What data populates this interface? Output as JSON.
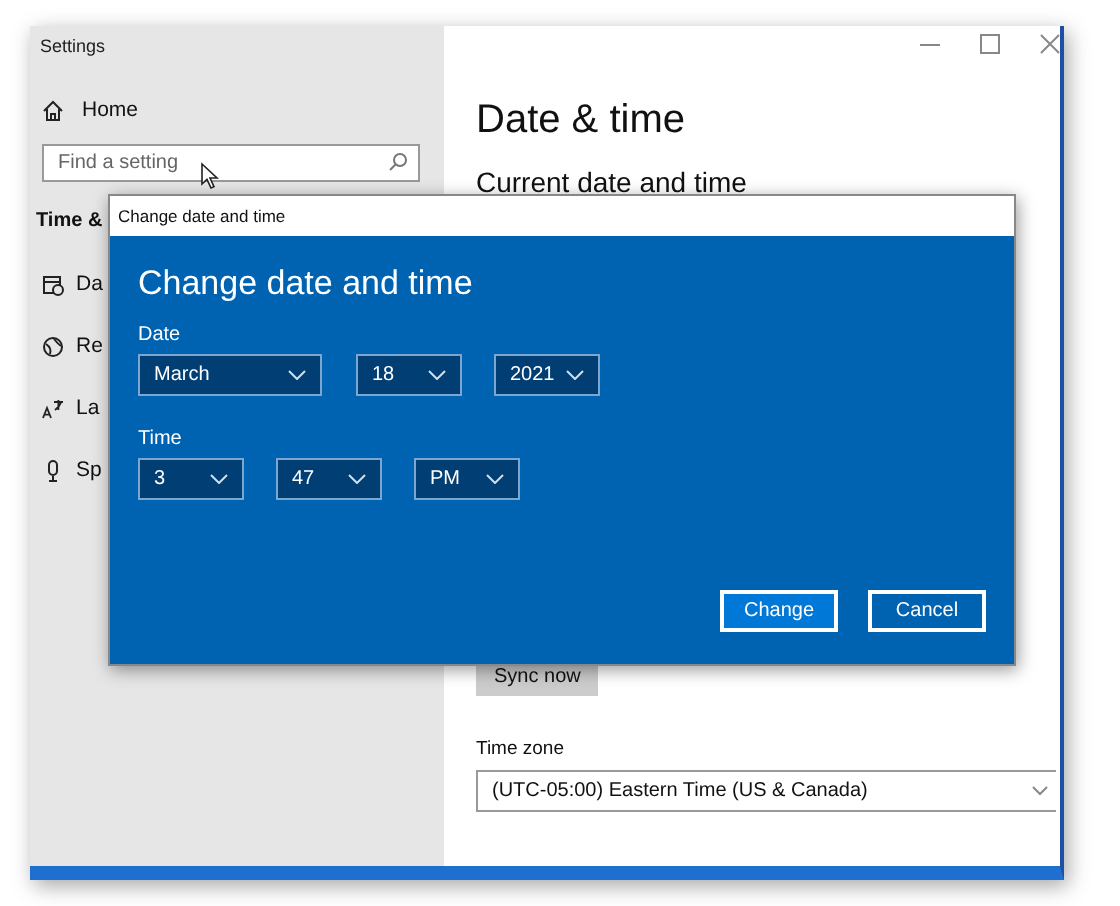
{
  "window": {
    "title": "Settings"
  },
  "sidebar": {
    "home": "Home",
    "search": {
      "placeholder": "Find a setting"
    },
    "section": "Time &",
    "items": [
      {
        "label": "Da"
      },
      {
        "label": "Re"
      },
      {
        "label": "La"
      },
      {
        "label": "Sp"
      }
    ]
  },
  "content": {
    "title": "Date & time",
    "subtitle": "Current date and time",
    "sync_button": "Sync now",
    "time_zone": {
      "label": "Time zone",
      "value": "(UTC-05:00) Eastern Time (US & Canada)"
    }
  },
  "dialog": {
    "title": "Change date and time",
    "heading": "Change date and time",
    "sections": [
      {
        "label": "Date",
        "fields": [
          {
            "value": "March"
          },
          {
            "value": "18"
          },
          {
            "value": "2021"
          }
        ]
      },
      {
        "label": "Time",
        "fields": [
          {
            "value": "3"
          },
          {
            "value": "47"
          },
          {
            "value": "PM"
          }
        ]
      }
    ],
    "buttons": [
      {
        "label": "Change",
        "kind": "primary"
      },
      {
        "label": "Cancel",
        "kind": "secondary"
      }
    ]
  }
}
